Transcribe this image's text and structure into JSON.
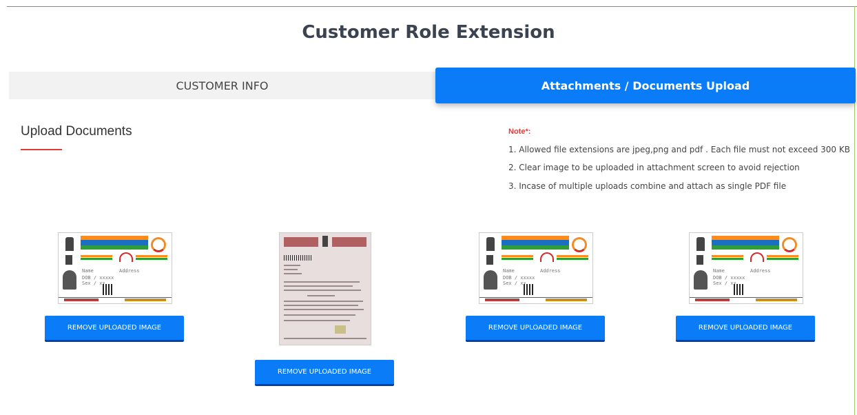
{
  "page": {
    "title": "Customer Role Extension"
  },
  "tabs": [
    {
      "label": "CUSTOMER INFO",
      "active": false
    },
    {
      "label": "Attachments / Documents Upload",
      "active": true
    }
  ],
  "upload": {
    "section_title": "Upload Documents"
  },
  "note": {
    "label": "Note*:",
    "lines": [
      "1. Allowed file extensions are jpeg,png and pdf . Each file must not exceed 300 KB",
      "2. Clear image to be uploaded in attachment screen to avoid rejection",
      "3. Incase of multiple uploads combine and attach as single PDF file"
    ]
  },
  "attachments": [
    {
      "type": "aadhaar-card",
      "button_label": "REMOVE UPLOADED IMAGE",
      "card": {
        "name_label": "Name",
        "dob_label": "DOB / xxxxx",
        "sex_label": "Sex / xx",
        "address_label": "Address"
      }
    },
    {
      "type": "document",
      "button_label": "REMOVE UPLOADED IMAGE"
    },
    {
      "type": "aadhaar-card",
      "button_label": "REMOVE UPLOADED IMAGE",
      "card": {
        "name_label": "Name",
        "dob_label": "DOB / xxxxx",
        "sex_label": "Sex / xx",
        "address_label": "Address"
      }
    },
    {
      "type": "aadhaar-card",
      "button_label": "REMOVE UPLOADED IMAGE",
      "card": {
        "name_label": "Name",
        "dob_label": "DOB / xxxxx",
        "sex_label": "Sex / xx",
        "address_label": "Address"
      }
    }
  ],
  "theme": {
    "primary": "#0a7cf7",
    "primary_dark": "#0d3f8c",
    "note_color": "#e53935",
    "tab_inactive_bg": "#f2f2f2"
  }
}
